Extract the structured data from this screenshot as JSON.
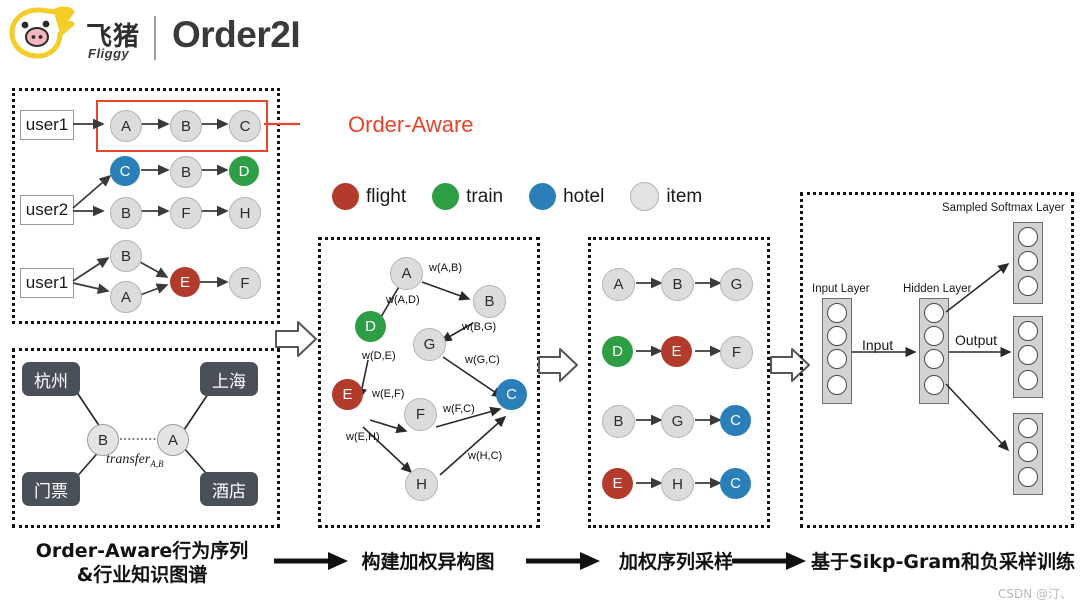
{
  "header": {
    "logo_icon": "fliggy-pig-logo-icon",
    "brand_cn": "飞猪",
    "brand_en": "Fliggy",
    "title": "Order2I"
  },
  "annotations": {
    "order_aware": "Order-Aware"
  },
  "legend": {
    "items": [
      {
        "label": "flight",
        "color": "#b23b2c",
        "key": "flight"
      },
      {
        "label": "train",
        "color": "#2e9e44",
        "key": "train"
      },
      {
        "label": "hotel",
        "color": "#2a7fb8",
        "key": "hotel"
      },
      {
        "label": "item",
        "color": "#dcdcdc",
        "key": "item"
      }
    ]
  },
  "panel_sequences": {
    "rows": [
      {
        "user": "user1",
        "nodes": [
          "A",
          "B",
          "C"
        ],
        "types": [
          "item",
          "item",
          "item"
        ],
        "highlighted": true
      },
      {
        "user": "user2",
        "branch_top": {
          "nodes": [
            "C",
            "B",
            "D"
          ],
          "types": [
            "hotel",
            "item",
            "train"
          ]
        },
        "branch_bottom": {
          "nodes": [
            "B",
            "F",
            "H"
          ],
          "types": [
            "item",
            "item",
            "item"
          ]
        }
      },
      {
        "user": "user1",
        "branch_top": {
          "nodes": [
            "B"
          ],
          "types": [
            "item"
          ]
        },
        "branch_bottom": {
          "nodes": [
            "A"
          ],
          "types": [
            "item"
          ]
        },
        "merge": {
          "nodes": [
            "E",
            "F"
          ],
          "types": [
            "flight",
            "item"
          ]
        }
      }
    ]
  },
  "panel_knowledge_graph": {
    "city_boxes": [
      {
        "label": "杭州",
        "pos": "top-left"
      },
      {
        "label": "上海",
        "pos": "top-right"
      },
      {
        "label": "门票",
        "pos": "bottom-left"
      },
      {
        "label": "酒店",
        "pos": "bottom-right"
      }
    ],
    "nodes": [
      {
        "label": "B"
      },
      {
        "label": "A"
      }
    ],
    "edge_label": "transfer",
    "edge_label_sub": "A,B"
  },
  "panel_weighted_graph": {
    "nodes": [
      {
        "label": "A",
        "type": "item"
      },
      {
        "label": "B",
        "type": "item"
      },
      {
        "label": "D",
        "type": "train"
      },
      {
        "label": "G",
        "type": "item"
      },
      {
        "label": "E",
        "type": "flight"
      },
      {
        "label": "F",
        "type": "item"
      },
      {
        "label": "C",
        "type": "hotel"
      },
      {
        "label": "H",
        "type": "item"
      }
    ],
    "edges": [
      {
        "label": "w(A,B)",
        "from": "A",
        "to": "B"
      },
      {
        "label": "w(A,D)",
        "from": "A",
        "to": "D"
      },
      {
        "label": "w(B,G)",
        "from": "B",
        "to": "G"
      },
      {
        "label": "w(G,C)",
        "from": "G",
        "to": "C"
      },
      {
        "label": "w(D,E)",
        "from": "D",
        "to": "E"
      },
      {
        "label": "w(E,F)",
        "from": "E",
        "to": "F"
      },
      {
        "label": "w(F,C)",
        "from": "F",
        "to": "C"
      },
      {
        "label": "w(E,H)",
        "from": "E",
        "to": "H"
      },
      {
        "label": "w(H,C)",
        "from": "H",
        "to": "C"
      }
    ]
  },
  "panel_sampled_sequences": {
    "sequences": [
      {
        "nodes": [
          "A",
          "B",
          "G"
        ],
        "types": [
          "item",
          "item",
          "item"
        ]
      },
      {
        "nodes": [
          "D",
          "E",
          "F"
        ],
        "types": [
          "train",
          "flight",
          "item"
        ]
      },
      {
        "nodes": [
          "B",
          "G",
          "C"
        ],
        "types": [
          "item",
          "item",
          "hotel"
        ]
      },
      {
        "nodes": [
          "E",
          "H",
          "C"
        ],
        "types": [
          "flight",
          "item",
          "hotel"
        ]
      }
    ]
  },
  "panel_network": {
    "labels": {
      "input_layer": "Input Layer",
      "hidden_layer": "Hidden Layer",
      "softmax_layer": "Sampled Softmax Layer",
      "input_arrow": "Input",
      "output_arrow": "Output"
    },
    "input_units": 4,
    "hidden_units": 4,
    "softmax_blocks": 3,
    "softmax_units_per_block": 3
  },
  "captions": {
    "step1_line1": "Order-Aware行为序列",
    "step1_line2": "&行业知识图谱",
    "step2": "构建加权异构图",
    "step3": "加权序列采样",
    "step4": "基于Sikp-Gram和负采样训练"
  },
  "watermark": "CSDN @汀、"
}
